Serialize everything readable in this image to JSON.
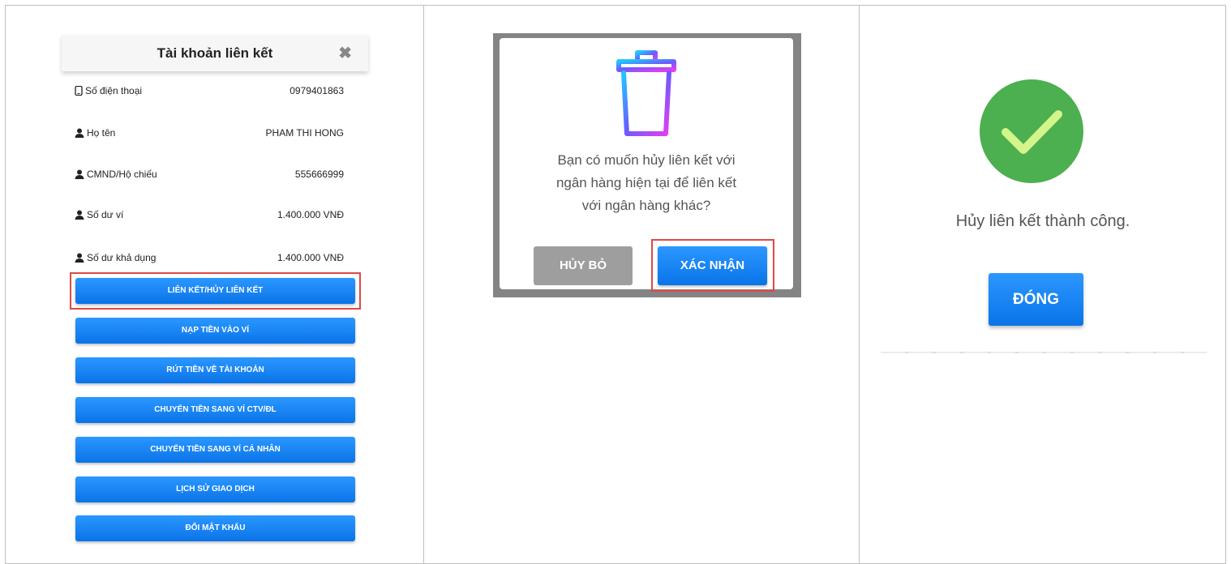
{
  "linked_account": {
    "title": "Tài khoản liên kết",
    "rows": [
      {
        "icon": "phone-icon",
        "label": "Số điện thoại",
        "value": "0979401863"
      },
      {
        "icon": "user-icon",
        "label": "Họ tên",
        "value": "PHAM THI HONG"
      },
      {
        "icon": "user-icon",
        "label": "CMND/Hộ chiếu",
        "value": "555666999"
      },
      {
        "icon": "user-icon",
        "label": "Số dư ví",
        "value": "1.400.000 VNĐ"
      },
      {
        "icon": "user-icon",
        "label": "Số dư khả dụng",
        "value": "1.400.000 VNĐ"
      }
    ],
    "buttons": [
      "LIÊN KẾT/HỦY LIÊN KẾT",
      "NẠP TIỀN VÀO VÍ",
      "RÚT TIỀN VỀ TÀI KHOẢN",
      "CHUYỂN TIỀN SANG VÍ CTV/ĐL",
      "CHUYỂN TIỀN SANG VÍ CÁ NHÂN",
      "LỊCH SỬ GIAO DỊCH",
      "ĐỔI MẬT KHẨU"
    ]
  },
  "confirm_dialog": {
    "icon": "trash-icon",
    "message_lines": [
      "Bạn có muốn hủy liên kết với",
      "ngân hàng hiện tại để liên kết",
      "với ngân hàng khác?"
    ],
    "cancel_label": "HỦY BỎ",
    "confirm_label": "XÁC NHẬN"
  },
  "success_dialog": {
    "icon": "check-circle-icon",
    "message": "Hủy liên kết thành công.",
    "close_label": "ĐÓNG"
  },
  "colors": {
    "primary": "#1482f0",
    "highlight": "#e04848",
    "success": "#4caf50",
    "check": "#d4f58a",
    "cancel": "#9e9e9e"
  }
}
